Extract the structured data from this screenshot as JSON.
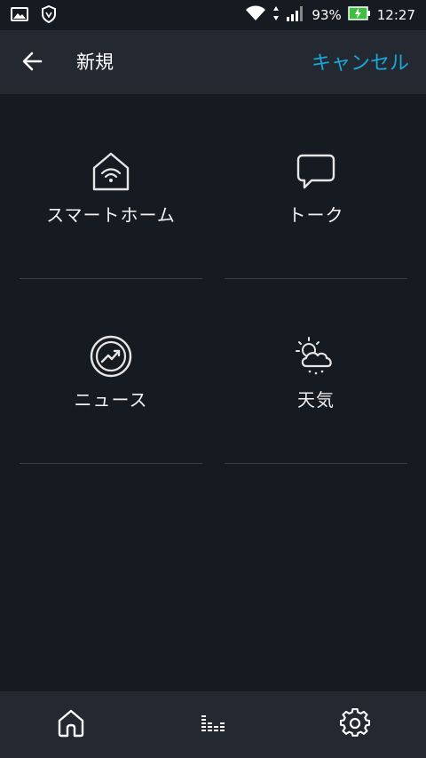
{
  "status_bar": {
    "battery_percent": "93%",
    "time": "12:27",
    "icons": [
      "gallery-icon",
      "shield-icon",
      "wifi-icon",
      "data-arrows-icon",
      "signal-icon",
      "battery-charging-icon"
    ]
  },
  "header": {
    "title": "新規",
    "cancel_label": "キャンセル",
    "back_icon": "arrow-left-icon"
  },
  "tiles": [
    {
      "label": "スマートホーム",
      "icon": "smart-home-icon"
    },
    {
      "label": "トーク",
      "icon": "speech-bubble-icon"
    },
    {
      "label": "ニュース",
      "icon": "news-icon"
    },
    {
      "label": "天気",
      "icon": "weather-icon"
    }
  ],
  "bottom_nav": {
    "items": [
      "home-icon",
      "equalizer-icon",
      "settings-gear-icon"
    ]
  },
  "colors": {
    "background": "#161a21",
    "header_bg": "#232831",
    "accent": "#1aa7d9",
    "text": "#ffffff"
  }
}
